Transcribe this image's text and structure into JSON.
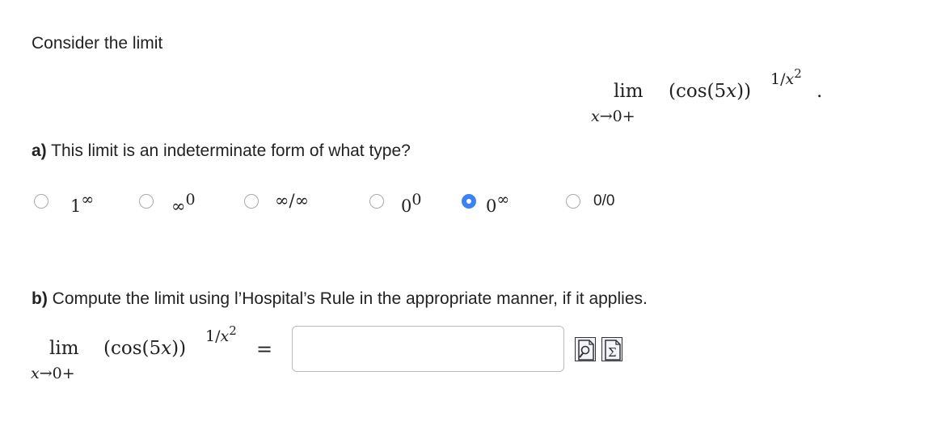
{
  "intro": {
    "text": "Consider the limit"
  },
  "limit_display": {
    "lim": "lim",
    "sub_var": "x",
    "sub_arrow": "→0+",
    "expr_open": "(cos(5",
    "expr_var": "x",
    "expr_close": "))",
    "exp_num": "1/",
    "exp_var": "x",
    "exp_pow": "2",
    "period": "."
  },
  "part_a": {
    "label": "a)",
    "question": "This limit is an indeterminate form of what type?",
    "options": [
      {
        "base": "1",
        "sup": "∞",
        "checked": false
      },
      {
        "base": "∞",
        "sup": "0",
        "checked": false
      },
      {
        "base": "∞/∞",
        "sup": "",
        "checked": false
      },
      {
        "base": "0",
        "sup": "0",
        "checked": false
      },
      {
        "base": "0",
        "sup": "∞",
        "checked": true
      },
      {
        "base": "0/0",
        "sup": "",
        "checked": false
      }
    ]
  },
  "part_b": {
    "label": "b)",
    "question": "Compute the limit using l’Hospital’s Rule in the appropriate manner, if it applies.",
    "equals": "=",
    "answer_value": ""
  },
  "tools": {
    "preview_icon": "preview-icon",
    "equation_icon": "equation-editor-icon",
    "sigma": "Σ"
  },
  "colors": {
    "radio_selected": "#3b82f6",
    "text": "#222222",
    "input_border": "#bbbbbb"
  }
}
